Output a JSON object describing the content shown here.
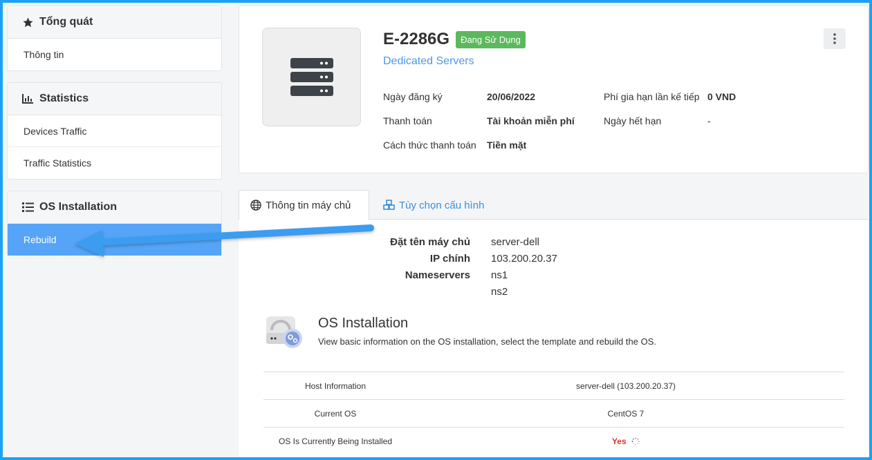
{
  "sidebar": {
    "overview": {
      "title": "Tổng quát",
      "items": [
        "Thông tin"
      ]
    },
    "statistics": {
      "title": "Statistics",
      "items": [
        "Devices Traffic",
        "Traffic Statistics"
      ]
    },
    "os": {
      "title": "OS Installation",
      "items": [
        "Rebuild"
      ]
    }
  },
  "product": {
    "name": "E-2286G",
    "status": "Đang Sử Dụng",
    "category": "Dedicated Servers",
    "left": [
      {
        "label": "Ngày đăng ký",
        "value": "20/06/2022"
      },
      {
        "label": "Thanh toán",
        "value": "Tài khoản miễn phí"
      },
      {
        "label": "Cách thức thanh toán",
        "value": "Tiền mặt"
      }
    ],
    "right": [
      {
        "label": "Phí gia hạn lần kế tiếp",
        "value": "0 VND"
      },
      {
        "label": "Ngày hết hạn",
        "value": "-"
      }
    ]
  },
  "tabs": [
    "Thông tin máy chủ",
    "Tùy chọn cấu hình"
  ],
  "server": {
    "name_label": "Đặt tên máy chủ",
    "name_value": "server-dell",
    "ip_label": "IP chính",
    "ip_value": "103.200.20.37",
    "ns_label": "Nameservers",
    "ns1": "ns1",
    "ns2": "ns2"
  },
  "os_install": {
    "title": "OS Installation",
    "description": "View basic information on the OS installation, select the template and rebuild the OS.",
    "rows": [
      {
        "label": "Host Information",
        "value": "server-dell (103.200.20.37)"
      },
      {
        "label": "Current OS",
        "value": "CentOS 7"
      },
      {
        "label": "OS Is Currently Being Installed",
        "value": "Yes"
      }
    ]
  },
  "colors": {
    "accent": "#55a4f7",
    "badge": "#5cb85c",
    "link": "#4a9ae6",
    "frame": "#1da1f2",
    "yes": "#d9342b"
  }
}
